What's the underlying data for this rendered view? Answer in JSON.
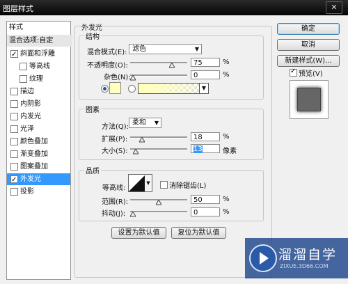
{
  "window": {
    "title": "图层样式",
    "close": "✕"
  },
  "sidebar": {
    "header": "样式",
    "blend": "混合选项:自定",
    "items": [
      {
        "label": "斜面和浮雕",
        "checked": true,
        "indent": false
      },
      {
        "label": "等高线",
        "checked": false,
        "indent": true
      },
      {
        "label": "纹理",
        "checked": false,
        "indent": true
      },
      {
        "label": "描边",
        "checked": false,
        "indent": false
      },
      {
        "label": "内阴影",
        "checked": false,
        "indent": false
      },
      {
        "label": "内发光",
        "checked": false,
        "indent": false
      },
      {
        "label": "光泽",
        "checked": false,
        "indent": false
      },
      {
        "label": "颜色叠加",
        "checked": false,
        "indent": false
      },
      {
        "label": "渐变叠加",
        "checked": false,
        "indent": false
      },
      {
        "label": "图案叠加",
        "checked": false,
        "indent": false
      },
      {
        "label": "外发光",
        "checked": true,
        "indent": false,
        "selected": true
      },
      {
        "label": "投影",
        "checked": false,
        "indent": false
      }
    ]
  },
  "panel": {
    "title": "外发光",
    "structure": {
      "title": "结构",
      "blend_mode_label": "混合模式(E):",
      "blend_mode_value": "滤色",
      "opacity_label": "不透明度(O):",
      "opacity_value": "75",
      "opacity_unit": "%",
      "opacity_level": 0.75,
      "noise_label": "杂色(N):",
      "noise_value": "0",
      "noise_unit": "%",
      "noise_level": 0,
      "color": "#ffffc0"
    },
    "elements": {
      "title": "图素",
      "method_label": "方法(Q):",
      "method_value": "柔和",
      "spread_label": "扩展(P):",
      "spread_value": "18",
      "spread_unit": "%",
      "spread_level": 0.18,
      "size_label": "大小(S):",
      "size_value": "13",
      "size_unit": "像素",
      "size_level": 0.052
    },
    "quality": {
      "title": "品质",
      "contour_label": "等高线:",
      "antialias_label": "消除锯齿(L)",
      "range_label": "范围(R):",
      "range_value": "50",
      "range_unit": "%",
      "range_level": 0.5,
      "jitter_label": "抖动(J):",
      "jitter_value": "0",
      "jitter_unit": "%",
      "jitter_level": 0
    },
    "make_default": "设置为默认值",
    "reset_default": "复位为默认值"
  },
  "buttons": {
    "ok": "确定",
    "cancel": "取消",
    "new_style": "新建样式(W)...",
    "preview": "预览(V)"
  },
  "watermark": {
    "name": "溜溜自学",
    "url": "ZIXUE.3D66.COM"
  }
}
